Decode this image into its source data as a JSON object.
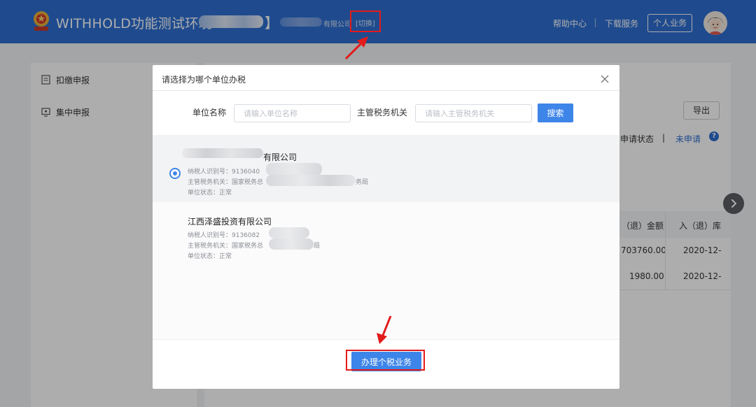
{
  "header": {
    "app_title": "WITHHOLD功能测试环境",
    "bracket": "】",
    "company_suffix": "有限公司",
    "switch_label": "[切换]",
    "help_center": "帮助中心",
    "download_service": "下载服务",
    "personal_business": "个人业务"
  },
  "sidebar": {
    "items": [
      {
        "label": "扣缴申报",
        "icon": "form-icon"
      },
      {
        "label": "集中申报",
        "icon": "monitor-icon"
      }
    ]
  },
  "background": {
    "export_label": "导出",
    "apply_status_label": "申请状态",
    "separator": "|",
    "apply_status_value": "未申请",
    "help_glyph": "?",
    "table": {
      "headers": [
        "（退）金额",
        "入（退）库"
      ],
      "rows": [
        [
          "703760.00",
          "2020-12-"
        ],
        [
          "1980.00",
          "2020-12-"
        ]
      ]
    }
  },
  "dialog": {
    "title": "请选择为哪个单位办税",
    "unit_name_label": "单位名称",
    "unit_name_placeholder": "请输入单位名称",
    "tax_authority_label": "主管税务机关",
    "tax_authority_placeholder": "请输入主管税务机关",
    "search_label": "搜索",
    "options": [
      {
        "selected": true,
        "name": "有限公司",
        "taxpayer_id": "纳税人识别号：9136040",
        "tax_authority": "主管税务机关：国家税务总",
        "tax_authority_suffix": "务局",
        "status": "单位状态：正常"
      },
      {
        "selected": false,
        "name": "江西泽盛投资有限公司",
        "taxpayer_id": "纳税人识别号：9136082",
        "tax_authority": "主管税务机关：国家税务总",
        "tax_authority_suffix": "局",
        "status": "单位状态：正常"
      }
    ],
    "confirm_label": "办理个税业务"
  }
}
